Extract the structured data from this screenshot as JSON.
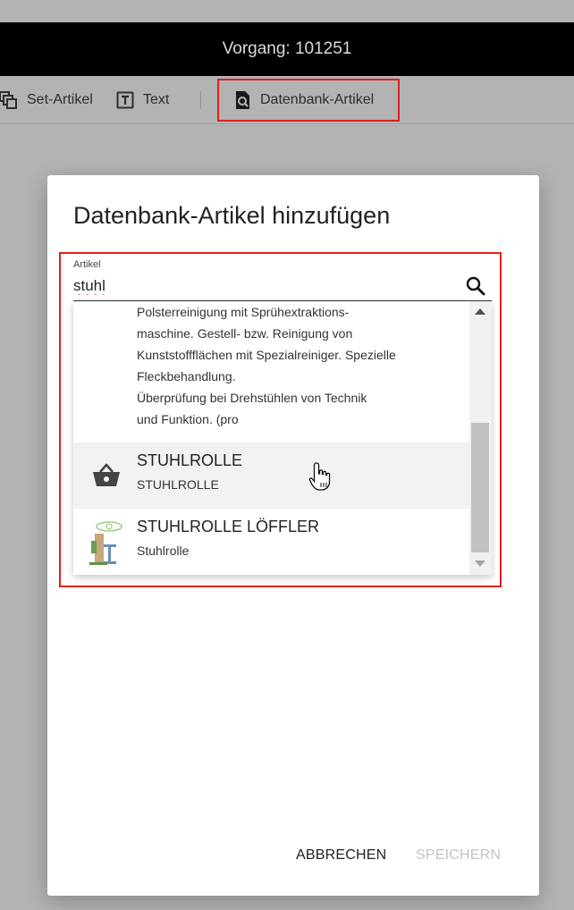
{
  "window": {
    "title": "Vorgang: 101251"
  },
  "toolbar": {
    "set_article": {
      "label": "Set-Artikel",
      "icon": "copy-stack-icon"
    },
    "text": {
      "label": "Text",
      "icon": "text-box-icon"
    },
    "db_article": {
      "label": "Datenbank-Artikel",
      "icon": "database-search-icon"
    }
  },
  "dialog": {
    "title": "Datenbank-Artikel hinzufügen",
    "field": {
      "label": "Artikel",
      "value": "stuhl",
      "icon": "search-icon"
    },
    "results": {
      "description_lines": [
        "Polsterreinigung mit Sprühextraktions-",
        "maschine. Gestell- bzw. Reinigung von",
        "Kunststoffflächen mit Spezialreiniger. Spezielle",
        "Fleckbehandlung.",
        "Überprüfung bei Drehstühlen von Technik",
        "und Funktion. (pro"
      ],
      "items": [
        {
          "title": "STUHLROLLE",
          "subtitle": "STUHLROLLE",
          "icon": "shopping-basket-icon"
        },
        {
          "title": "STUHLROLLE LÖFFLER",
          "subtitle": "Stuhlrolle",
          "icon": "product-thumbnail"
        }
      ]
    },
    "actions": {
      "cancel": "ABBRECHEN",
      "save": "SPEICHERN"
    }
  },
  "colors": {
    "highlight": "#e02020",
    "titlebar": "#000000",
    "overlay": "#b3b3b3"
  }
}
